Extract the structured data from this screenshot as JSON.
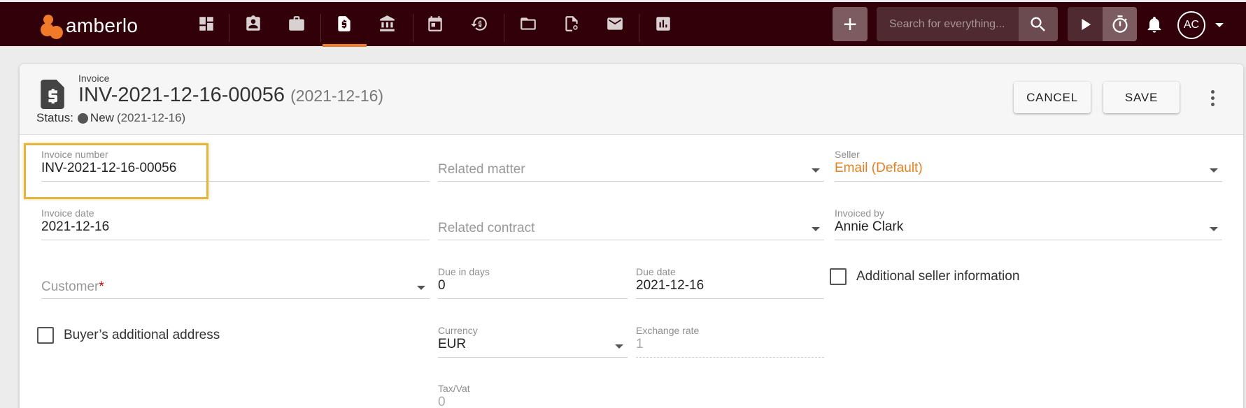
{
  "app": {
    "logo_text": "amberlo",
    "brand_color": "#f07a2a",
    "topbar_color": "#320009"
  },
  "nav": {
    "icons": [
      "dashboard-icon",
      "contacts-icon",
      "matters-icon",
      "invoices-icon",
      "bank-icon",
      "calendar-icon",
      "time-billing-icon",
      "folder-icon",
      "contract-icon",
      "mail-icon",
      "reports-icon"
    ],
    "active": "invoices-icon"
  },
  "topbar": {
    "add_label": "+",
    "search_placeholder": "Search for everything...",
    "avatar_initials": "AC"
  },
  "header": {
    "kind": "Invoice",
    "title": "INV-2021-12-16-00056",
    "title_date": "(2021-12-16)",
    "status_label": "Status:",
    "status_value": "New",
    "status_date": "(2021-12-16)",
    "cancel_label": "CANCEL",
    "save_label": "SAVE"
  },
  "form": {
    "invoice_number": {
      "label": "Invoice number",
      "value": "INV-2021-12-16-00056"
    },
    "related_matter": {
      "placeholder": "Related matter"
    },
    "seller": {
      "label": "Seller",
      "value": "Email (Default)"
    },
    "invoice_date": {
      "label": "Invoice date",
      "value": "2021-12-16"
    },
    "related_contract": {
      "placeholder": "Related contract"
    },
    "invoiced_by": {
      "label": "Invoiced by",
      "value": "Annie Clark"
    },
    "customer": {
      "placeholder": "Customer",
      "required_mark": "*"
    },
    "due_in_days": {
      "label": "Due in days",
      "value": "0"
    },
    "due_date": {
      "label": "Due date",
      "value": "2021-12-16"
    },
    "additional_seller_info": {
      "label": "Additional seller information",
      "checked": false
    },
    "buyer_additional_address": {
      "label": "Buyer’s additional address",
      "checked": false
    },
    "currency": {
      "label": "Currency",
      "value": "EUR"
    },
    "exchange_rate": {
      "label": "Exchange rate",
      "value": "1"
    },
    "tax_vat": {
      "label": "Tax/Vat",
      "value": "0"
    }
  }
}
